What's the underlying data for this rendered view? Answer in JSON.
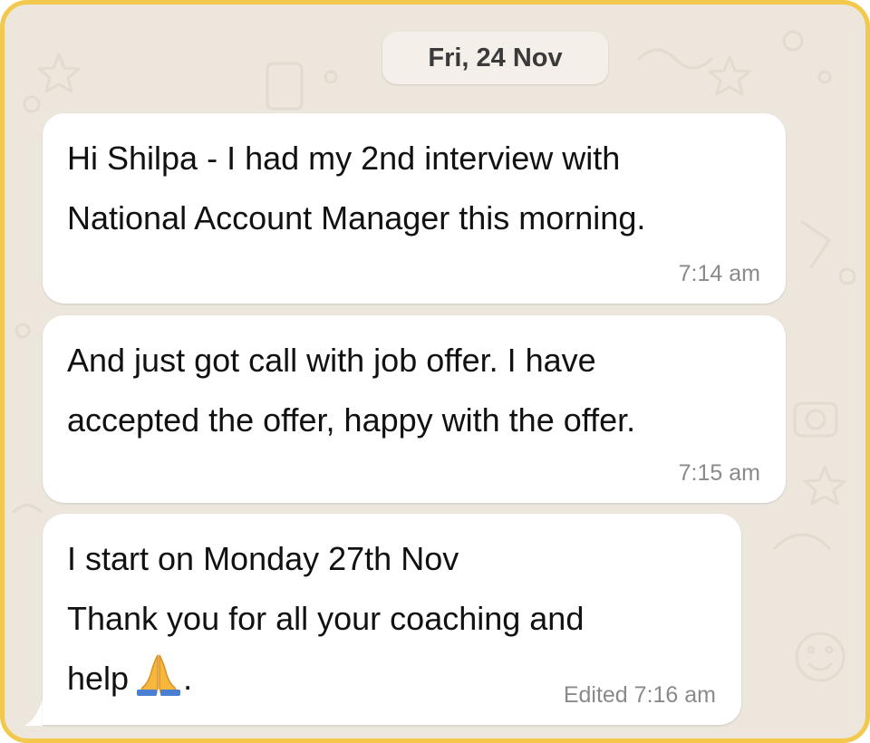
{
  "chat": {
    "date_label": "Fri, 24 Nov",
    "messages": [
      {
        "text": "Hi Shilpa - I had my 2nd interview with\nNational Account Manager this morning.",
        "time": "7:14 am"
      },
      {
        "text": "And just got call with job offer. I have\naccepted the offer, happy with the offer.",
        "time": "7:15 am"
      },
      {
        "text_line1": "I start on Monday 27th Nov",
        "text_line2": "Thank you for all your coaching and",
        "text_line3_before_emoji": "help",
        "emoji_name": "folded-hands-icon",
        "text_line3_after_emoji": ".",
        "time": "Edited 7:16 am"
      }
    ]
  },
  "colors": {
    "frame_border": "#f2c94c",
    "wallpaper": "#ece6dd",
    "bubble": "#ffffff",
    "timestamp": "#8a8a8a"
  }
}
